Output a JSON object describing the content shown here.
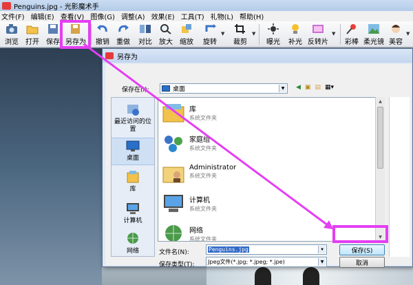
{
  "app": {
    "title": "Penguins.jpg - 光影魔术手"
  },
  "menu": [
    "文件(F)",
    "编辑(E)",
    "查看(V)",
    "图像(G)",
    "调整(A)",
    "效果(E)",
    "工具(T)",
    "礼物(L)",
    "帮助(H)"
  ],
  "toolbar": {
    "browse": "浏览",
    "open": "打开",
    "save": "保存",
    "save_as": "另存为",
    "undo": "撤销",
    "redo": "重做",
    "compare": "对比",
    "zoom_in": "放大",
    "zoom": "缩放",
    "rotate": "旋转",
    "crop": "裁剪",
    "exposure": "曝光",
    "fill_light": "补光",
    "invert": "反转片",
    "color_pen": "彩棒",
    "soft_lens": "柔光镜",
    "beauty": "美容"
  },
  "dialog": {
    "title": "另存为",
    "save_in_label": "保存在(I):",
    "save_in_value": "桌面",
    "places": [
      {
        "label": "最近访问的位置"
      },
      {
        "label": "桌面"
      },
      {
        "label": "库"
      },
      {
        "label": "计算机"
      },
      {
        "label": "网络"
      }
    ],
    "files": [
      {
        "name": "库",
        "type": "系统文件夹"
      },
      {
        "name": "家庭组",
        "type": "系统文件夹"
      },
      {
        "name": "Administrator",
        "type": "系统文件夹"
      },
      {
        "name": "计算机",
        "type": "系统文件夹"
      },
      {
        "name": "网络",
        "type": "系统文件夹"
      }
    ],
    "filename_label": "文件名(N):",
    "filename_value": "Penguins.jpg",
    "filetype_label": "保存类型(T):",
    "filetype_value": "Jpeg文件(*.jpg; *.jpeg; *.jpe)",
    "save_button": "保存(S)",
    "cancel_button": "取消"
  },
  "colors": {
    "highlight": "#e43ef2",
    "accent": "#3169c6"
  }
}
